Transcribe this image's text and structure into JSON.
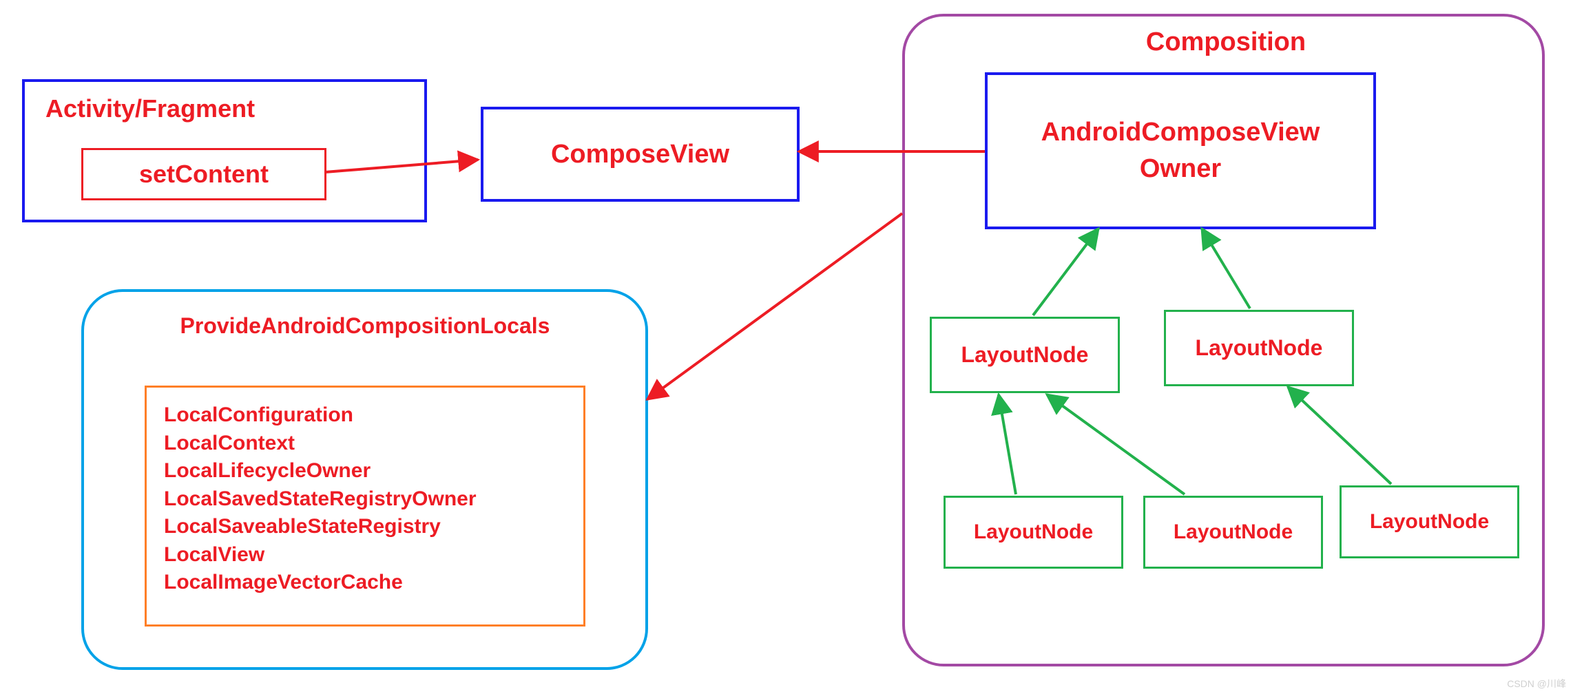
{
  "activity": {
    "title": "Activity/Fragment",
    "button": "setContent"
  },
  "composeView": "ComposeView",
  "composition": {
    "title": "Composition",
    "owner": {
      "line1": "AndroidComposeView",
      "line2": "Owner"
    },
    "nodes": {
      "mid_left": "LayoutNode",
      "mid_right": "LayoutNode",
      "leaf1": "LayoutNode",
      "leaf2": "LayoutNode",
      "leaf3": "LayoutNode"
    }
  },
  "provide": {
    "title": "ProvideAndroidCompositionLocals",
    "locals": "LocalConfiguration\nLocalContext\nLocalLifecycleOwner\nLocalSavedStateRegistryOwner\nLocalSaveableStateRegistry\nLocalView\nLocalImageVectorCache"
  },
  "watermark": "CSDN @川峰",
  "colors": {
    "red": "#ed1c24",
    "blue": "#1a1aef",
    "orange": "#ff7f27",
    "green": "#22b14c",
    "purple": "#a349a4",
    "cyan": "#00a2e8"
  }
}
